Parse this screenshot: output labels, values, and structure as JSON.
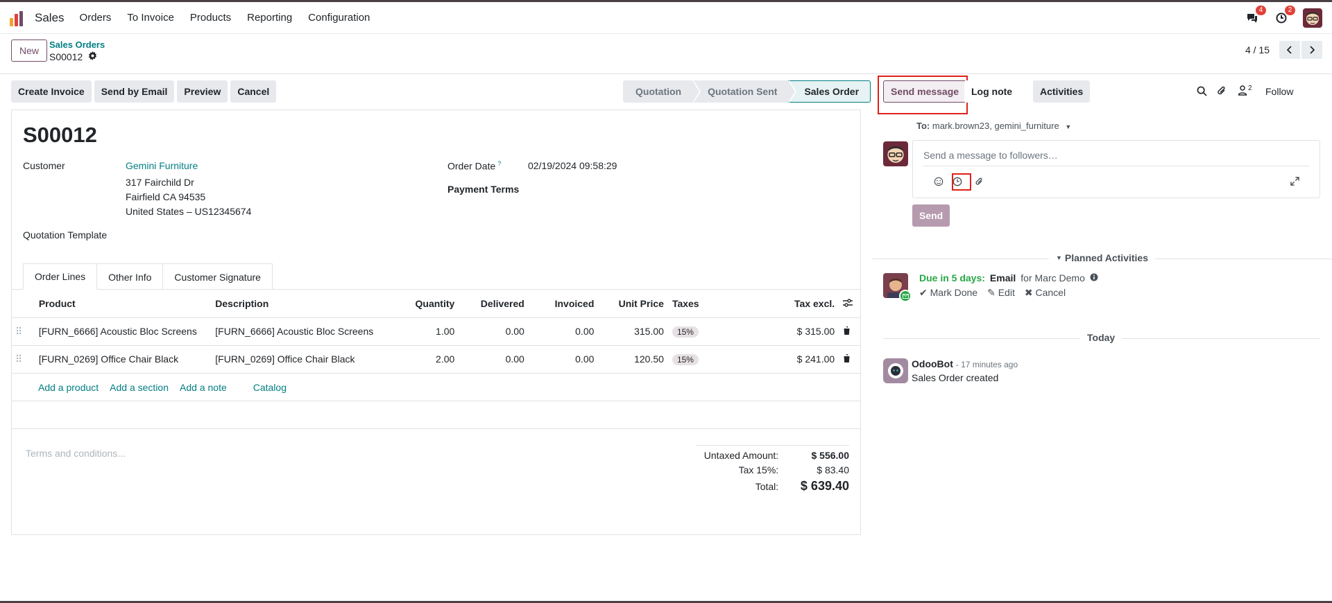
{
  "navbar": {
    "app_name": "Sales",
    "menu": [
      "Orders",
      "To Invoice",
      "Products",
      "Reporting",
      "Configuration"
    ],
    "messages_count": "4",
    "activities_count": "2"
  },
  "control": {
    "new_label": "New",
    "breadcrumb_parent": "Sales Orders",
    "breadcrumb_current": "S00012",
    "pager": "4 / 15"
  },
  "actions": [
    "Create Invoice",
    "Send by Email",
    "Preview",
    "Cancel"
  ],
  "statusbar": [
    "Quotation",
    "Quotation Sent",
    "Sales Order"
  ],
  "form": {
    "title": "S00012",
    "customer_label": "Customer",
    "customer_name": "Gemini Furniture",
    "address": [
      "317 Fairchild Dr",
      "Fairfield CA 94535",
      "United States – US12345674"
    ],
    "quotation_template_label": "Quotation Template",
    "order_date_label": "Order Date",
    "order_date_help": "?",
    "order_date": "02/19/2024 09:58:29",
    "payment_terms_label": "Payment Terms",
    "tabs": [
      "Order Lines",
      "Other Info",
      "Customer Signature"
    ],
    "columns": {
      "product": "Product",
      "description": "Description",
      "quantity": "Quantity",
      "delivered": "Delivered",
      "invoiced": "Invoiced",
      "unit_price": "Unit Price",
      "taxes": "Taxes",
      "tax_excl": "Tax excl."
    },
    "lines": [
      {
        "product": "[FURN_6666] Acoustic Bloc Screens",
        "description": "[FURN_6666] Acoustic Bloc Screens",
        "quantity": "1.00",
        "delivered": "0.00",
        "invoiced": "0.00",
        "unit_price": "315.00",
        "taxes": "15%",
        "subtotal": "$ 315.00"
      },
      {
        "product": "[FURN_0269] Office Chair Black",
        "description": "[FURN_0269] Office Chair Black",
        "quantity": "2.00",
        "delivered": "0.00",
        "invoiced": "0.00",
        "unit_price": "120.50",
        "taxes": "15%",
        "subtotal": "$ 241.00"
      }
    ],
    "add_links": [
      "Add a product",
      "Add a section",
      "Add a note",
      "Catalog"
    ],
    "terms_placeholder": "Terms and conditions...",
    "totals": {
      "untaxed_label": "Untaxed Amount:",
      "untaxed": "$ 556.00",
      "tax_label": "Tax 15%:",
      "tax": "$ 83.40",
      "total_label": "Total:",
      "total": "$ 639.40"
    }
  },
  "chatter": {
    "send_message": "Send message",
    "log_note": "Log note",
    "activities": "Activities",
    "followers_count": "2",
    "follow": "Follow",
    "to_label": "To:",
    "to_recipients": "mark.brown23, gemini_furniture",
    "composer_placeholder": "Send a message to followers…",
    "send": "Send",
    "planned_title": "Planned Activities",
    "activity": {
      "due": "Due in 5 days:",
      "type": "Email",
      "for": "for Marc Demo",
      "mark_done": "Mark Done",
      "edit": "Edit",
      "cancel": "Cancel"
    },
    "today_label": "Today",
    "message": {
      "author": "OdooBot",
      "time": "- 17 minutes ago",
      "body": "Sales Order created"
    }
  },
  "colors": {
    "brand": "#714b67",
    "link": "#017e84",
    "highlight": "#e0201a",
    "success": "#28a745"
  }
}
